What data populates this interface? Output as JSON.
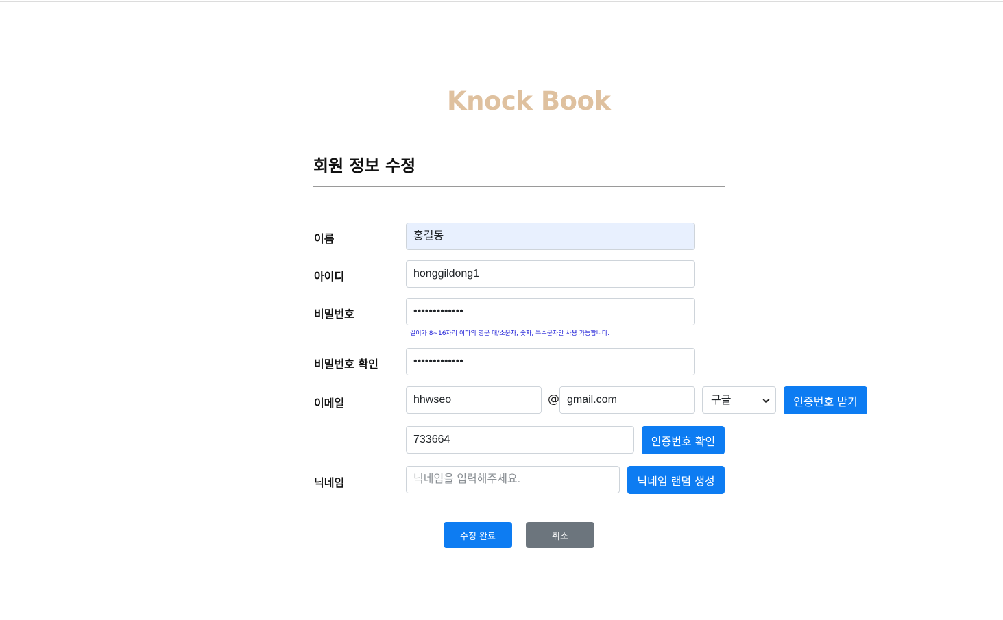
{
  "logo": "Knock Book",
  "page_title": "회원 정보 수정",
  "form": {
    "name": {
      "label": "이름",
      "value": "홍길동"
    },
    "user_id": {
      "label": "아이디",
      "value": "honggildong1"
    },
    "password": {
      "label": "비밀번호",
      "value": "•••••••••••••",
      "hint": "길이가 8~16자리 이하의 영문 대/소문자, 숫자, 특수문자만 사용 가능합니다."
    },
    "password_confirm": {
      "label": "비밀번호 확인",
      "value": "•••••••••••••"
    },
    "email": {
      "label": "이메일",
      "local": "hhwseo",
      "at": "@",
      "domain": "gmail.com",
      "provider_selected": "구글",
      "request_code_button": "인증번호 받기",
      "code_value": "733664",
      "verify_code_button": "인증번호 확인"
    },
    "nickname": {
      "label": "닉네임",
      "placeholder": "닉네임을 입력해주세요.",
      "random_button": "닉네임 랜덤 생성"
    }
  },
  "actions": {
    "submit": "수정 완료",
    "cancel": "취소"
  },
  "colors": {
    "primary": "#0d7cf2",
    "secondary": "#6c757d",
    "logo": "#dfc19f",
    "autofill": "#e8f0fe"
  }
}
